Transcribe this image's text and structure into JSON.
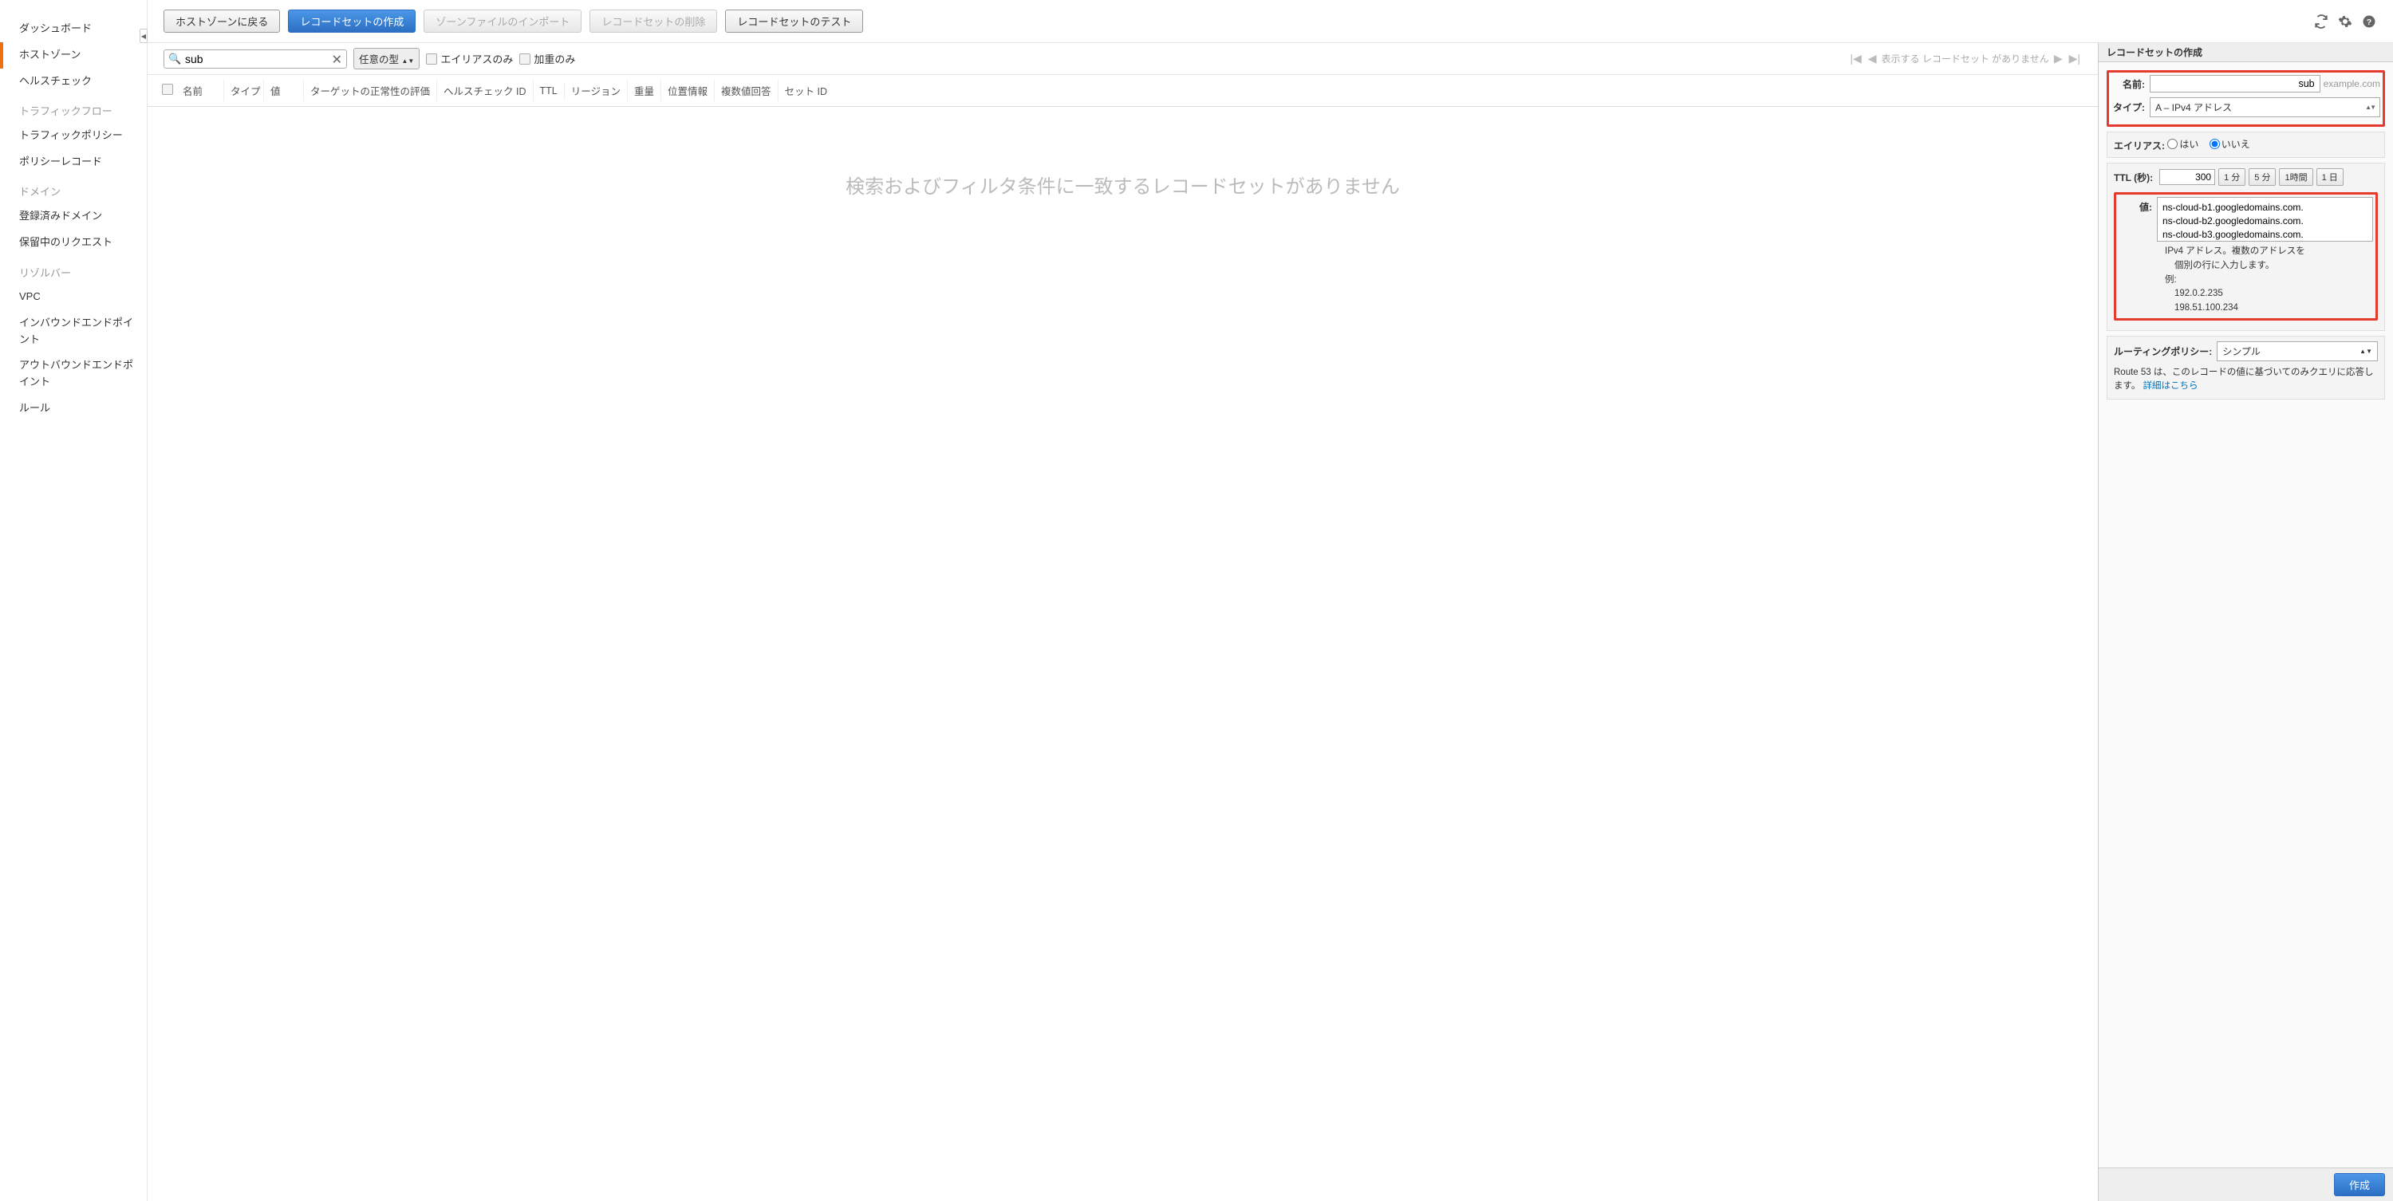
{
  "sidebar": {
    "items": [
      {
        "label": "ダッシュボード",
        "active": false
      },
      {
        "label": "ホストゾーン",
        "active": true
      },
      {
        "label": "ヘルスチェック",
        "active": false
      }
    ],
    "groups": [
      {
        "header": "トラフィックフロー",
        "items": [
          "トラフィックポリシー",
          "ポリシーレコード"
        ]
      },
      {
        "header": "ドメイン",
        "items": [
          "登録済みドメイン",
          "保留中のリクエスト"
        ]
      },
      {
        "header": "リゾルバー",
        "items": [
          "VPC",
          "インバウンドエンドポイント",
          "アウトバウンドエンドポイント",
          "ルール"
        ]
      }
    ]
  },
  "toolbar": {
    "back": "ホストゾーンに戻る",
    "create": "レコードセットの作成",
    "import": "ゾーンファイルのインポート",
    "delete": "レコードセットの削除",
    "test": "レコードセットのテスト"
  },
  "filter": {
    "search_value": "sub",
    "type_any": "任意の型",
    "alias_only": "エイリアスのみ",
    "weighted_only": "加重のみ",
    "pager_text": "表示する レコードセット がありません"
  },
  "columns": [
    "名前",
    "タイプ",
    "値",
    "ターゲットの正常性の評価",
    "ヘルスチェック ID",
    "TTL",
    "リージョン",
    "重量",
    "位置情報",
    "複数値回答",
    "セット ID"
  ],
  "table_empty": "検索およびフィルタ条件に一致するレコードセットがありません",
  "panel": {
    "title": "レコードセットの作成",
    "name_label": "名前:",
    "name_value": "sub",
    "name_suffix": "example.com",
    "type_label": "タイプ:",
    "type_value": "A – IPv4 アドレス",
    "alias_label": "エイリアス:",
    "alias_yes": "はい",
    "alias_no": "いいえ",
    "ttl_label": "TTL (秒):",
    "ttl_value": "300",
    "ttl_presets": [
      "1 分",
      "5 分",
      "1時間",
      "1 日"
    ],
    "value_label": "値:",
    "value_text": "ns-cloud-b1.googledomains.com.\nns-cloud-b2.googledomains.com.\nns-cloud-b3.googledomains.com.",
    "value_help1": "IPv4 アドレス。複数のアドレスを",
    "value_help2": "個別の行に入力します。",
    "value_help3": "例:",
    "value_help4": "192.0.2.235",
    "value_help5": "198.51.100.234",
    "routing_label": "ルーティングポリシー:",
    "routing_value": "シンプル",
    "routing_desc": "Route 53 は、このレコードの値に基づいてのみクエリに応答します。",
    "routing_link": "詳細はこちら",
    "create_btn": "作成"
  }
}
